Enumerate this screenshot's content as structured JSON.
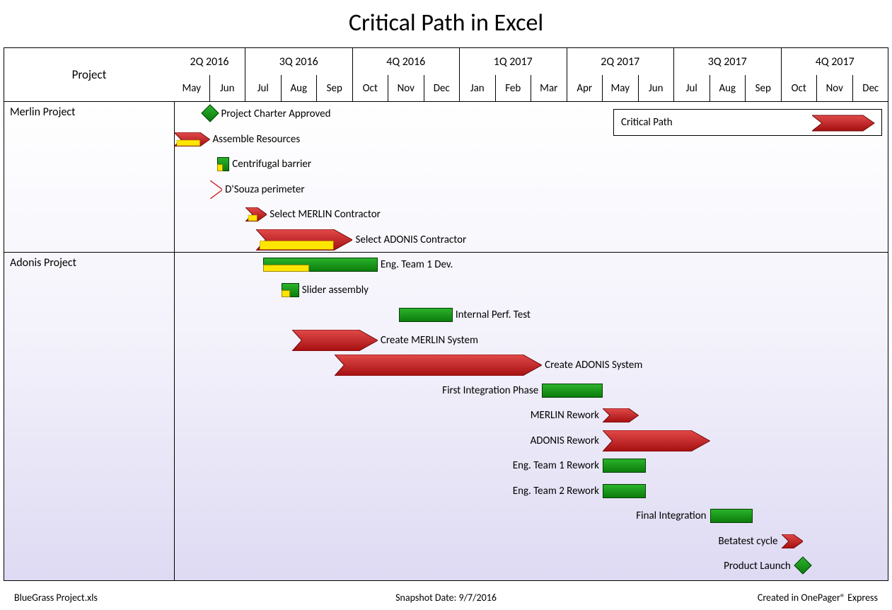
{
  "title": "Critical Path in Excel",
  "projectHeader": "Project",
  "legend": {
    "label": "Critical Path"
  },
  "footer": {
    "left": "BlueGrass Project.xls",
    "mid": "Snapshot Date: 9/7/2016",
    "right": "Created in OnePager® Express"
  },
  "quarters": [
    {
      "label": "2Q 2016",
      "span": 2
    },
    {
      "label": "3Q 2016",
      "span": 3
    },
    {
      "label": "4Q 2016",
      "span": 3
    },
    {
      "label": "1Q 2017",
      "span": 3
    },
    {
      "label": "2Q 2017",
      "span": 3
    },
    {
      "label": "3Q 2017",
      "span": 3
    },
    {
      "label": "4Q 2017",
      "span": 3
    }
  ],
  "months": [
    "May",
    "Jun",
    "Jul",
    "Aug",
    "Sep",
    "Oct",
    "Nov",
    "Dec",
    "Jan",
    "Feb",
    "Mar",
    "Apr",
    "May",
    "Jun",
    "Jul",
    "Aug",
    "Sep",
    "Oct",
    "Nov",
    "Dec"
  ],
  "swimlanes": [
    {
      "name": "Merlin Project",
      "startRow": 0
    },
    {
      "name": "Adonis Project",
      "startRow": 6
    }
  ],
  "tasks": [
    {
      "row": 0,
      "label": "Project Charter Approved",
      "labelSide": "right",
      "type": "diamond",
      "start": 1.0,
      "end": 1.0
    },
    {
      "row": 1,
      "label": "Assemble Resources",
      "labelSide": "right",
      "type": "critArrowYellow",
      "start": 0.0,
      "end": 1.0
    },
    {
      "row": 2,
      "label": "Centrifugal barrier",
      "labelSide": "right",
      "type": "greenYellow",
      "start": 1.2,
      "end": 1.55,
      "yellowFrac": 0.5
    },
    {
      "row": 3,
      "label": "D'Souza perimeter",
      "labelSide": "right",
      "type": "outlineChevron",
      "start": 1.0,
      "end": 1.35
    },
    {
      "row": 4,
      "label": "Select MERLIN Contractor",
      "labelSide": "right",
      "type": "critArrowYellow",
      "start": 2.0,
      "end": 2.6
    },
    {
      "row": 5,
      "label": "Select ADONIS Contractor",
      "labelSide": "right",
      "type": "critArrowYellowBig",
      "start": 2.3,
      "end": 5.0
    },
    {
      "row": 6,
      "label": "Eng. Team 1 Dev.",
      "labelSide": "right",
      "type": "greenYellow",
      "start": 2.5,
      "end": 5.7,
      "yellowFrac": 0.4
    },
    {
      "row": 7,
      "label": "Slider assembly",
      "labelSide": "right",
      "type": "greenYellow",
      "start": 3.0,
      "end": 3.5,
      "yellowFrac": 0.5
    },
    {
      "row": 8,
      "label": "Internal Perf. Test",
      "labelSide": "right",
      "type": "green",
      "start": 6.3,
      "end": 7.8
    },
    {
      "row": 9,
      "label": "Create MERLIN System",
      "labelSide": "right",
      "type": "critArrowBig",
      "start": 3.3,
      "end": 5.7
    },
    {
      "row": 10,
      "label": "Create ADONIS System",
      "labelSide": "right",
      "type": "critArrowBig",
      "start": 4.5,
      "end": 10.3
    },
    {
      "row": 11,
      "label": "First Integration Phase",
      "labelSide": "left",
      "type": "green",
      "start": 10.3,
      "end": 12.0
    },
    {
      "row": 12,
      "label": "MERLIN Rework",
      "labelSide": "left",
      "type": "critArrow",
      "start": 12.0,
      "end": 13.0
    },
    {
      "row": 13,
      "label": "ADONIS Rework",
      "labelSide": "left",
      "type": "critArrowBig",
      "start": 12.0,
      "end": 15.0
    },
    {
      "row": 14,
      "label": "Eng. Team 1 Rework",
      "labelSide": "left",
      "type": "green",
      "start": 12.0,
      "end": 13.2
    },
    {
      "row": 15,
      "label": "Eng. Team 2 Rework",
      "labelSide": "left",
      "type": "green",
      "start": 12.0,
      "end": 13.2
    },
    {
      "row": 16,
      "label": "Final Integration",
      "labelSide": "left",
      "type": "green",
      "start": 15.0,
      "end": 16.2
    },
    {
      "row": 17,
      "label": "Betatest cycle",
      "labelSide": "left",
      "type": "critArrow",
      "start": 17.0,
      "end": 17.6
    },
    {
      "row": 18,
      "label": "Product Launch",
      "labelSide": "left",
      "type": "diamond",
      "start": 17.6,
      "end": 17.6
    }
  ],
  "chart_data": {
    "type": "bar",
    "orientation": "gantt",
    "title": "Critical Path in Excel",
    "x_axis": {
      "unit": "month",
      "start": "2016-05",
      "end": "2017-12",
      "tick_labels": [
        "May",
        "Jun",
        "Jul",
        "Aug",
        "Sep",
        "Oct",
        "Nov",
        "Dec",
        "Jan",
        "Feb",
        "Mar",
        "Apr",
        "May",
        "Jun",
        "Jul",
        "Aug",
        "Sep",
        "Oct",
        "Nov",
        "Dec"
      ]
    },
    "groups": [
      {
        "name": "Merlin Project",
        "tasks": [
          {
            "name": "Project Charter Approved",
            "start": "2016-06",
            "end": "2016-06",
            "kind": "milestone",
            "critical": false
          },
          {
            "name": "Assemble Resources",
            "start": "2016-05",
            "end": "2016-06",
            "kind": "task",
            "critical": true,
            "progress": 0.5
          },
          {
            "name": "Centrifugal barrier",
            "start": "2016-06",
            "end": "2016-06",
            "kind": "task",
            "critical": false,
            "progress": 0.5
          },
          {
            "name": "D'Souza perimeter",
            "start": "2016-06",
            "end": "2016-06",
            "kind": "task",
            "critical": false,
            "progress": 0
          },
          {
            "name": "Select MERLIN Contractor",
            "start": "2016-07",
            "end": "2016-07",
            "kind": "task",
            "critical": true,
            "progress": 0.5
          },
          {
            "name": "Select ADONIS Contractor",
            "start": "2016-07",
            "end": "2016-10",
            "kind": "task",
            "critical": true,
            "progress": 0.5
          }
        ]
      },
      {
        "name": "Adonis Project",
        "tasks": [
          {
            "name": "Eng. Team 1 Dev.",
            "start": "2016-07",
            "end": "2016-10",
            "kind": "task",
            "critical": false,
            "progress": 0.4
          },
          {
            "name": "Slider assembly",
            "start": "2016-08",
            "end": "2016-08",
            "kind": "task",
            "critical": false,
            "progress": 0.5
          },
          {
            "name": "Internal Perf. Test",
            "start": "2016-11",
            "end": "2016-12",
            "kind": "task",
            "critical": false
          },
          {
            "name": "Create MERLIN System",
            "start": "2016-08",
            "end": "2016-10",
            "kind": "task",
            "critical": true
          },
          {
            "name": "Create ADONIS System",
            "start": "2016-09",
            "end": "2017-03",
            "kind": "task",
            "critical": true
          },
          {
            "name": "First Integration Phase",
            "start": "2017-03",
            "end": "2017-05",
            "kind": "task",
            "critical": false
          },
          {
            "name": "MERLIN Rework",
            "start": "2017-05",
            "end": "2017-06",
            "kind": "task",
            "critical": true
          },
          {
            "name": "ADONIS Rework",
            "start": "2017-05",
            "end": "2017-08",
            "kind": "task",
            "critical": true
          },
          {
            "name": "Eng. Team 1 Rework",
            "start": "2017-05",
            "end": "2017-06",
            "kind": "task",
            "critical": false
          },
          {
            "name": "Eng. Team 2 Rework",
            "start": "2017-05",
            "end": "2017-06",
            "kind": "task",
            "critical": false
          },
          {
            "name": "Final Integration",
            "start": "2017-08",
            "end": "2017-09",
            "kind": "task",
            "critical": false
          },
          {
            "name": "Betatest cycle",
            "start": "2017-10",
            "end": "2017-10",
            "kind": "task",
            "critical": true
          },
          {
            "name": "Product Launch",
            "start": "2017-10",
            "end": "2017-10",
            "kind": "milestone",
            "critical": false
          }
        ]
      }
    ],
    "legend": [
      {
        "label": "Critical Path",
        "style": "red-arrow"
      }
    ]
  }
}
